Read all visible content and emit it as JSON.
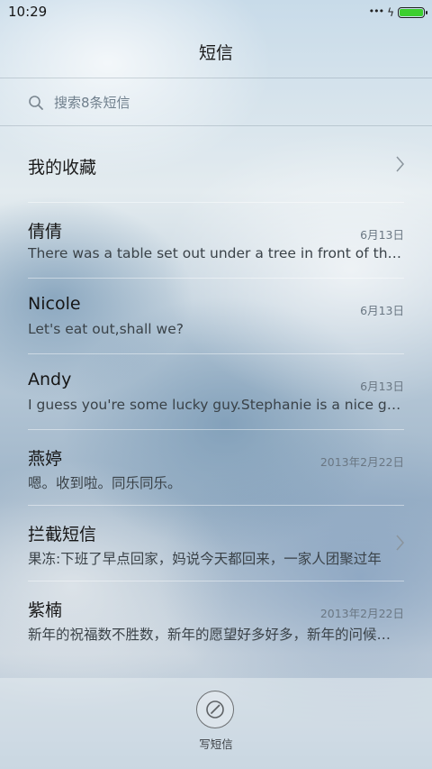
{
  "status": {
    "time": "10:29",
    "signal_icon": "dots-icon",
    "charging_icon": "bolt-icon",
    "battery_icon": "battery-icon",
    "battery_level": 1.0,
    "battery_color": "#3ccf2f"
  },
  "header": {
    "title": "短信"
  },
  "search": {
    "placeholder": "搜索8条短信"
  },
  "favorites": {
    "label": "我的收藏"
  },
  "conversations": [
    {
      "name": "倩倩",
      "date": "6月13日",
      "snippet": "There was a table set out under a tree in front of the house"
    },
    {
      "name": "Nicole",
      "date": "6月13日",
      "snippet": "Let's eat out,shall we?"
    },
    {
      "name": "Andy",
      "date": "6月13日",
      "snippet": "I guess you're some lucky guy.Stephanie is a nice girl."
    },
    {
      "name": "燕婷",
      "date": "2013年2月22日",
      "snippet": "嗯。收到啦。同乐同乐。"
    },
    {
      "name": "拦截短信",
      "date": "",
      "snippet": "果冻:下班了早点回家，妈说今天都回来，一家人团聚过年"
    },
    {
      "name": "紫楠",
      "date": "2013年2月22日",
      "snippet": "新年的祝福数不胜数，新年的愿望好多好多，新年的问候送给你"
    }
  ],
  "bottom": {
    "compose_label": "写短信"
  }
}
